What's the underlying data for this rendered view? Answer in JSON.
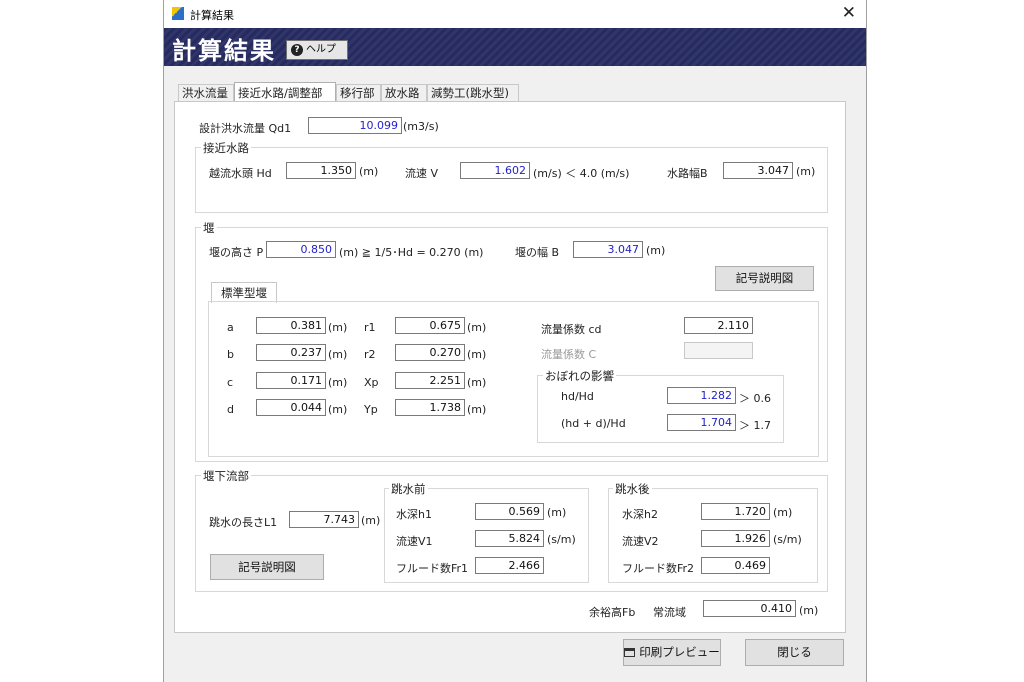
{
  "window": {
    "title": "計算結果",
    "banner_title": "計算結果",
    "help_label": "ヘルプ"
  },
  "tabs": [
    "洪水流量",
    "接近水路/調整部",
    "移行部",
    "放水路",
    "減勢工(跳水型)"
  ],
  "design": {
    "label": "設計洪水流量 Qd1",
    "value": "10.099",
    "unit": "(m3/s)"
  },
  "approach": {
    "title": "接近水路",
    "hd_label": "越流水頭 Hd",
    "hd_value": "1.350",
    "hd_unit": "(m)",
    "v_label": "流速 V",
    "v_value": "1.602",
    "v_unit": "(m/s) ＜ 4.0 (m/s)",
    "b_label": "水路幅B",
    "b_value": "3.047",
    "b_unit": "(m)"
  },
  "weir": {
    "title": "堰",
    "p_label": "堰の高さ P",
    "p_value": "0.850",
    "p_unit": "(m) ≧ 1/5･Hd = 0.270 (m)",
    "b_label": "堰の幅 B",
    "b_value": "3.047",
    "b_unit": "(m)",
    "diagram_button": "記号説明図",
    "subtab": "標準型堰",
    "params_left": [
      {
        "label": "a",
        "value": "0.381",
        "unit": "(m)"
      },
      {
        "label": "b",
        "value": "0.237",
        "unit": "(m)"
      },
      {
        "label": "c",
        "value": "0.171",
        "unit": "(m)"
      },
      {
        "label": "d",
        "value": "0.044",
        "unit": "(m)"
      }
    ],
    "params_right": [
      {
        "label": "r1",
        "value": "0.675",
        "unit": "(m)"
      },
      {
        "label": "r2",
        "value": "0.270",
        "unit": "(m)"
      },
      {
        "label": "Xp",
        "value": "2.251",
        "unit": "(m)"
      },
      {
        "label": "Yp",
        "value": "1.738",
        "unit": "(m)"
      }
    ],
    "cd_label": "流量係数 cd",
    "cd_value": "2.110",
    "c_label": "流量係数 C",
    "c_value": "",
    "sub_title": "おぼれの影響",
    "hd_ratio_label": "hd/Hd",
    "hd_ratio_value": "1.282",
    "hd_ratio_cmp": "＞ 0.6",
    "hdd_ratio_label": "(hd + d)/Hd",
    "hdd_ratio_value": "1.704",
    "hdd_ratio_cmp": "＞ 1.7"
  },
  "downstream": {
    "title": "堰下流部",
    "l1_label": "跳水の長さL1",
    "l1_value": "7.743",
    "l1_unit": "(m)",
    "diagram_button": "記号説明図",
    "before": {
      "title": "跳水前",
      "h1_label": "水深h1",
      "h1_value": "0.569",
      "h1_unit": "(m)",
      "v1_label": "流速V1",
      "v1_value": "5.824",
      "v1_unit": "(s/m)",
      "fr1_label": "フルード数Fr1",
      "fr1_value": "2.466"
    },
    "after": {
      "title": "跳水後",
      "h2_label": "水深h2",
      "h2_value": "1.720",
      "h2_unit": "(m)",
      "v2_label": "流速V2",
      "v2_value": "1.926",
      "v2_unit": "(s/m)",
      "fr2_label": "フルード数Fr2",
      "fr2_value": "0.469"
    }
  },
  "freeboard": {
    "label": "余裕高Fb",
    "regime": "常流域",
    "value": "0.410",
    "unit": "(m)"
  },
  "footer": {
    "print_label": "印刷プレビュー",
    "close_label": "閉じる"
  }
}
